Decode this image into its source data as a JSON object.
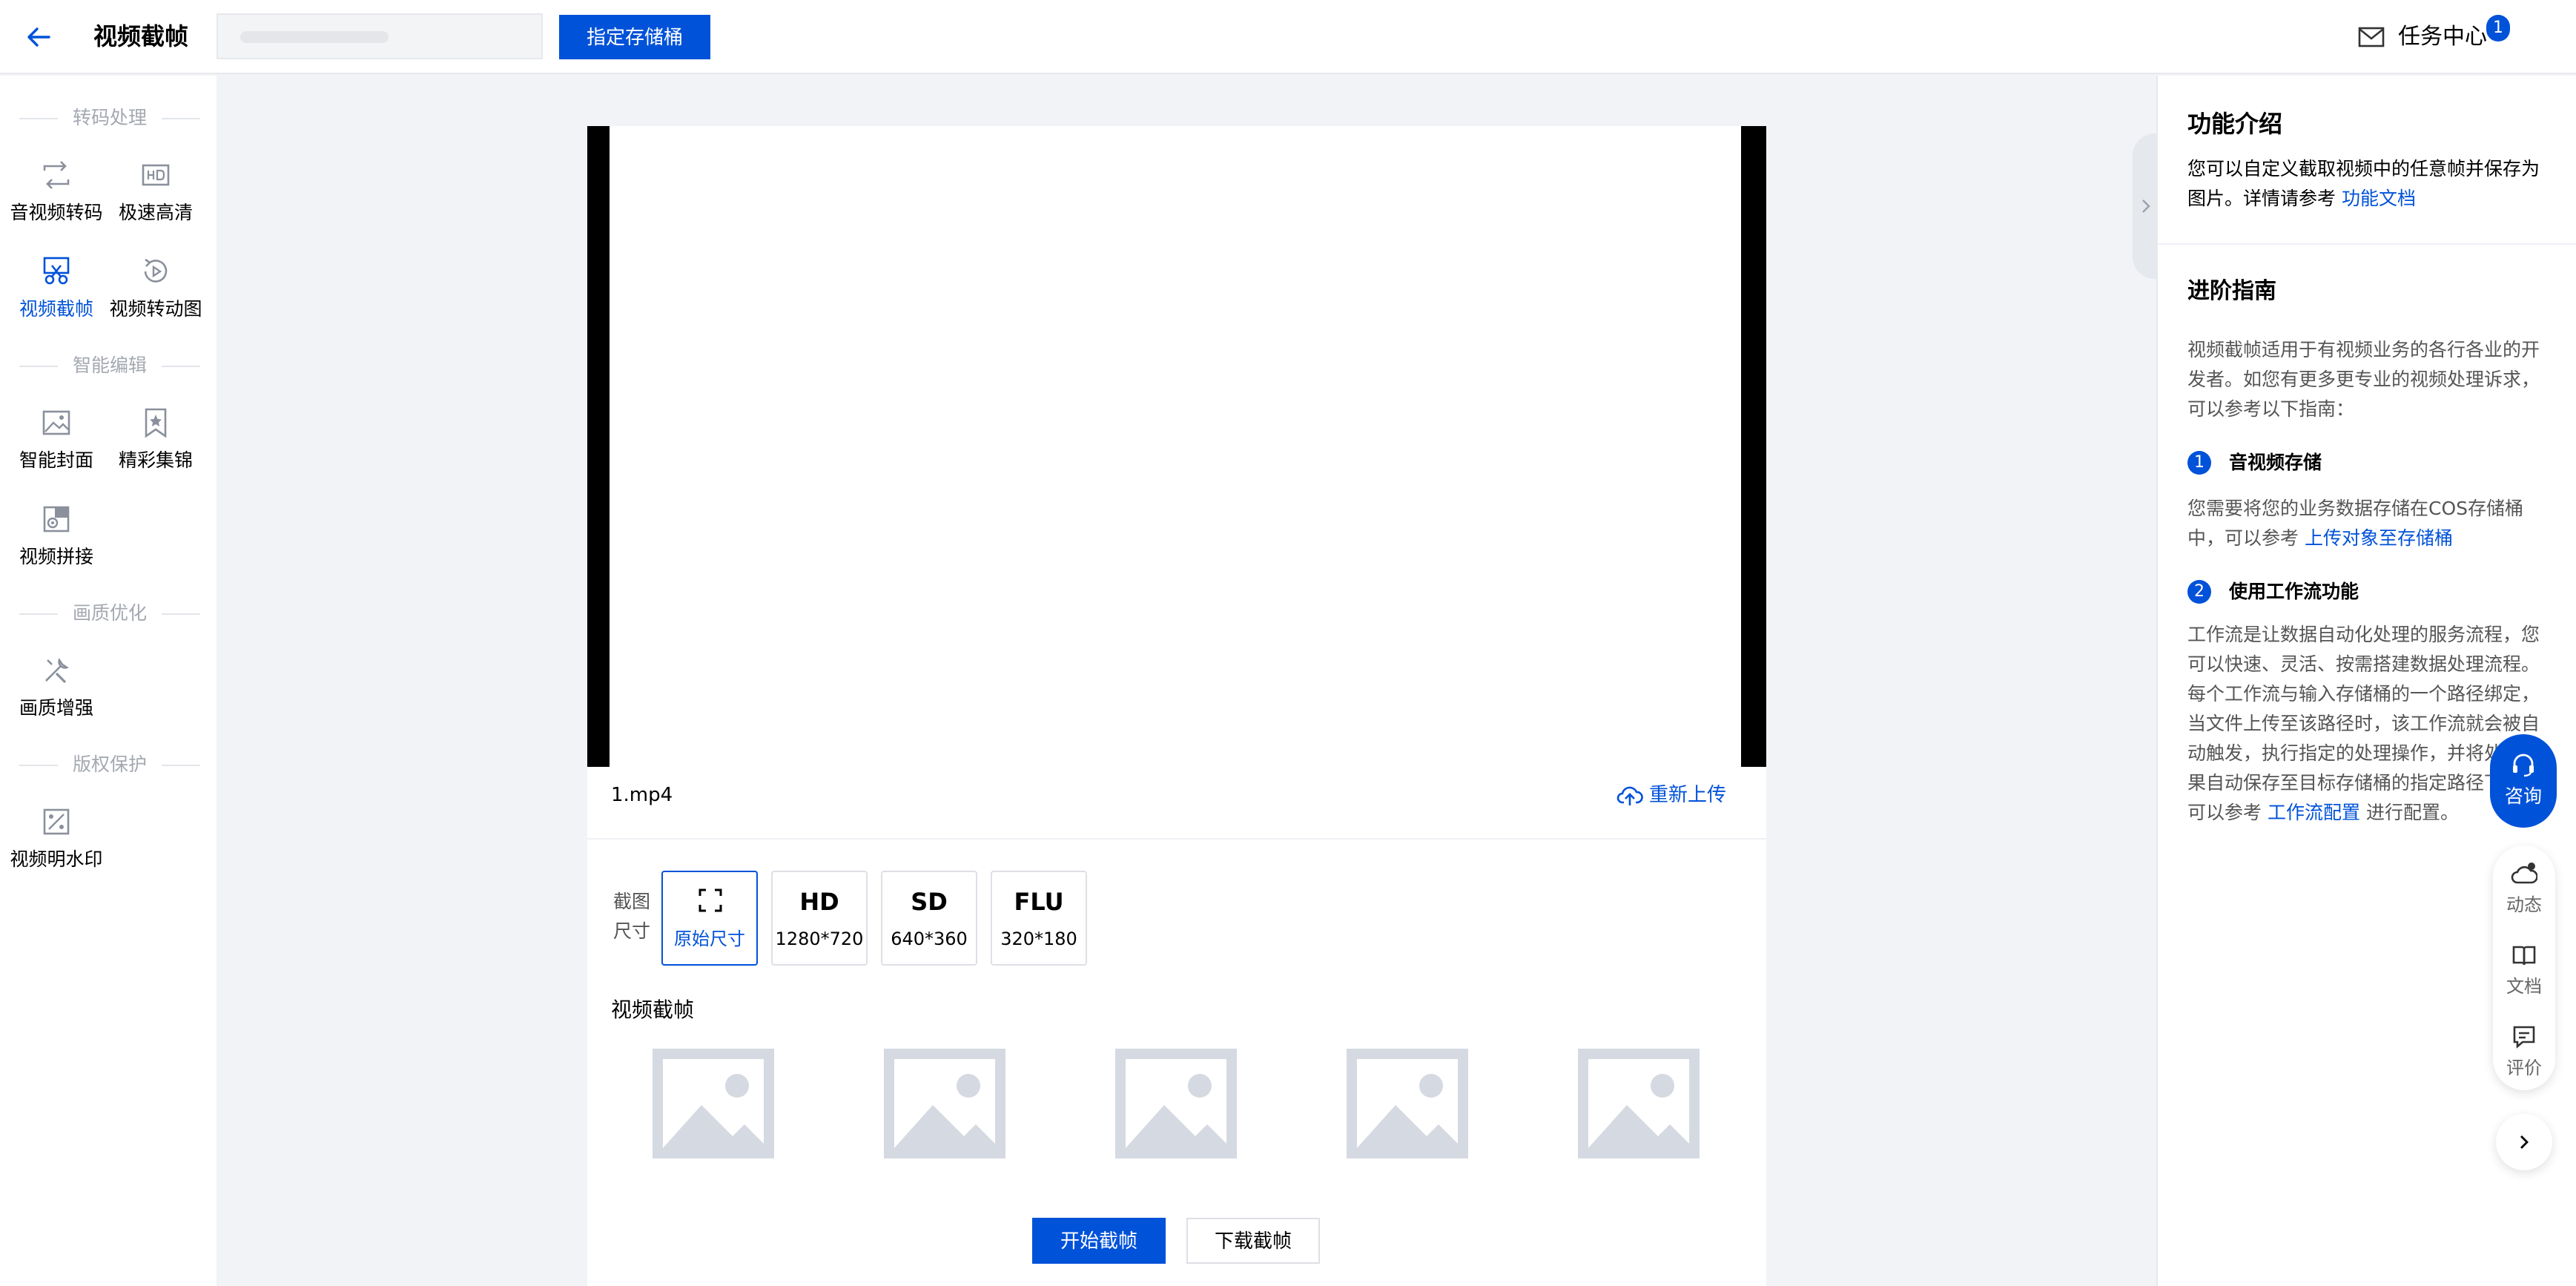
{
  "header": {
    "title": "视频截帧",
    "bucket_button": "指定存储桶",
    "task_center": "任务中心",
    "task_badge": "1"
  },
  "sidebar": {
    "sections": [
      {
        "title": "转码处理",
        "items": [
          {
            "label": "音视频转码",
            "icon": "transcode-icon"
          },
          {
            "label": "极速高清",
            "icon": "hd-icon"
          },
          {
            "label": "视频截帧",
            "icon": "scissors-icon",
            "active": true
          },
          {
            "label": "视频转动图",
            "icon": "loop-icon"
          }
        ]
      },
      {
        "title": "智能编辑",
        "items": [
          {
            "label": "智能封面",
            "icon": "image-icon"
          },
          {
            "label": "精彩集锦",
            "icon": "bookmark-star-icon"
          },
          {
            "label": "视频拼接",
            "icon": "splice-icon"
          }
        ]
      },
      {
        "title": "画质优化",
        "items": [
          {
            "label": "画质增强",
            "icon": "tools-icon"
          }
        ]
      },
      {
        "title": "版权保护",
        "items": [
          {
            "label": "视频明水印",
            "icon": "watermark-icon"
          }
        ]
      }
    ]
  },
  "main": {
    "file_name": "1.mp4",
    "reupload": "重新上传",
    "size_label": "截图尺寸",
    "sizes": [
      {
        "big": "",
        "small": "原始尺寸",
        "selected": true
      },
      {
        "big": "HD",
        "small": "1280*720"
      },
      {
        "big": "SD",
        "small": "640*360"
      },
      {
        "big": "FLU",
        "small": "320*180"
      }
    ],
    "frames_title": "视频截帧",
    "start_button": "开始截帧",
    "download_button": "下载截帧"
  },
  "right_panel": {
    "intro_title": "功能介绍",
    "intro_text": "您可以自定义截取视频中的任意帧并保存为图片。详情请参考",
    "intro_link": "功能文档",
    "guide_title": "进阶指南",
    "guide_text": "视频截帧适用于有视频业务的各行各业的开发者。如您有更多更专业的视频处理诉求，可以参考以下指南：",
    "step1_num": "1",
    "step1_title": "音视频存储",
    "step1_text": "您需要将您的业务数据存储在COS存储桶中，可以参考",
    "step1_link": "上传对象至存储桶",
    "step2_num": "2",
    "step2_title": "使用工作流功能",
    "step2_text": "工作流是让数据自动化处理的服务流程，您可以快速、灵活、按需搭建数据处理流程。每个工作流与输入存储桶的一个路径绑定，当文件上传至该路径时，该工作流就会被自动触发，执行指定的处理操作，并将处理结果自动保存至目标存储桶的指定路径下。您可以参考",
    "step2_link": "工作流配置",
    "step2_suffix": "进行配置。"
  },
  "floating": {
    "consult": "咨询",
    "items": [
      "动态",
      "文档",
      "评价"
    ]
  },
  "colors": {
    "primary": "#0052d9",
    "page_bg": "#f2f3f6",
    "placeholder": "#d5d9e1"
  }
}
